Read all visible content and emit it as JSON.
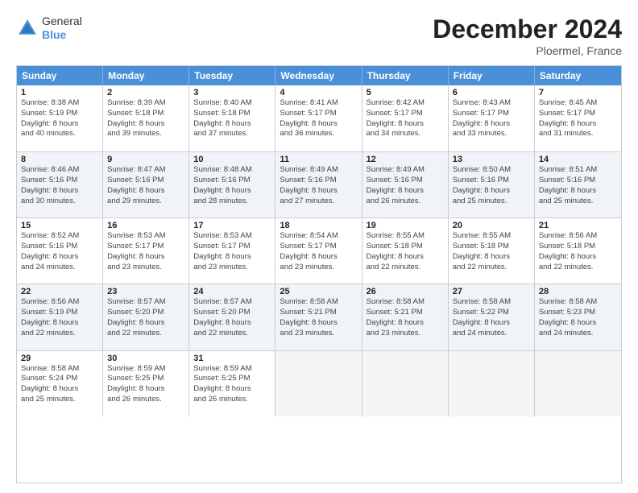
{
  "logo": {
    "general": "General",
    "blue": "Blue"
  },
  "title": "December 2024",
  "location": "Ploermel, France",
  "days": [
    "Sunday",
    "Monday",
    "Tuesday",
    "Wednesday",
    "Thursday",
    "Friday",
    "Saturday"
  ],
  "rows": [
    [
      {
        "day": "1",
        "lines": [
          "Sunrise: 8:38 AM",
          "Sunset: 5:19 PM",
          "Daylight: 8 hours",
          "and 40 minutes."
        ],
        "empty": false,
        "shaded": false
      },
      {
        "day": "2",
        "lines": [
          "Sunrise: 8:39 AM",
          "Sunset: 5:18 PM",
          "Daylight: 8 hours",
          "and 39 minutes."
        ],
        "empty": false,
        "shaded": false
      },
      {
        "day": "3",
        "lines": [
          "Sunrise: 8:40 AM",
          "Sunset: 5:18 PM",
          "Daylight: 8 hours",
          "and 37 minutes."
        ],
        "empty": false,
        "shaded": false
      },
      {
        "day": "4",
        "lines": [
          "Sunrise: 8:41 AM",
          "Sunset: 5:17 PM",
          "Daylight: 8 hours",
          "and 36 minutes."
        ],
        "empty": false,
        "shaded": false
      },
      {
        "day": "5",
        "lines": [
          "Sunrise: 8:42 AM",
          "Sunset: 5:17 PM",
          "Daylight: 8 hours",
          "and 34 minutes."
        ],
        "empty": false,
        "shaded": false
      },
      {
        "day": "6",
        "lines": [
          "Sunrise: 8:43 AM",
          "Sunset: 5:17 PM",
          "Daylight: 8 hours",
          "and 33 minutes."
        ],
        "empty": false,
        "shaded": false
      },
      {
        "day": "7",
        "lines": [
          "Sunrise: 8:45 AM",
          "Sunset: 5:17 PM",
          "Daylight: 8 hours",
          "and 31 minutes."
        ],
        "empty": false,
        "shaded": false
      }
    ],
    [
      {
        "day": "8",
        "lines": [
          "Sunrise: 8:46 AM",
          "Sunset: 5:16 PM",
          "Daylight: 8 hours",
          "and 30 minutes."
        ],
        "empty": false,
        "shaded": true
      },
      {
        "day": "9",
        "lines": [
          "Sunrise: 8:47 AM",
          "Sunset: 5:16 PM",
          "Daylight: 8 hours",
          "and 29 minutes."
        ],
        "empty": false,
        "shaded": true
      },
      {
        "day": "10",
        "lines": [
          "Sunrise: 8:48 AM",
          "Sunset: 5:16 PM",
          "Daylight: 8 hours",
          "and 28 minutes."
        ],
        "empty": false,
        "shaded": true
      },
      {
        "day": "11",
        "lines": [
          "Sunrise: 8:49 AM",
          "Sunset: 5:16 PM",
          "Daylight: 8 hours",
          "and 27 minutes."
        ],
        "empty": false,
        "shaded": true
      },
      {
        "day": "12",
        "lines": [
          "Sunrise: 8:49 AM",
          "Sunset: 5:16 PM",
          "Daylight: 8 hours",
          "and 26 minutes."
        ],
        "empty": false,
        "shaded": true
      },
      {
        "day": "13",
        "lines": [
          "Sunrise: 8:50 AM",
          "Sunset: 5:16 PM",
          "Daylight: 8 hours",
          "and 25 minutes."
        ],
        "empty": false,
        "shaded": true
      },
      {
        "day": "14",
        "lines": [
          "Sunrise: 8:51 AM",
          "Sunset: 5:16 PM",
          "Daylight: 8 hours",
          "and 25 minutes."
        ],
        "empty": false,
        "shaded": true
      }
    ],
    [
      {
        "day": "15",
        "lines": [
          "Sunrise: 8:52 AM",
          "Sunset: 5:16 PM",
          "Daylight: 8 hours",
          "and 24 minutes."
        ],
        "empty": false,
        "shaded": false
      },
      {
        "day": "16",
        "lines": [
          "Sunrise: 8:53 AM",
          "Sunset: 5:17 PM",
          "Daylight: 8 hours",
          "and 23 minutes."
        ],
        "empty": false,
        "shaded": false
      },
      {
        "day": "17",
        "lines": [
          "Sunrise: 8:53 AM",
          "Sunset: 5:17 PM",
          "Daylight: 8 hours",
          "and 23 minutes."
        ],
        "empty": false,
        "shaded": false
      },
      {
        "day": "18",
        "lines": [
          "Sunrise: 8:54 AM",
          "Sunset: 5:17 PM",
          "Daylight: 8 hours",
          "and 23 minutes."
        ],
        "empty": false,
        "shaded": false
      },
      {
        "day": "19",
        "lines": [
          "Sunrise: 8:55 AM",
          "Sunset: 5:18 PM",
          "Daylight: 8 hours",
          "and 22 minutes."
        ],
        "empty": false,
        "shaded": false
      },
      {
        "day": "20",
        "lines": [
          "Sunrise: 8:55 AM",
          "Sunset: 5:18 PM",
          "Daylight: 8 hours",
          "and 22 minutes."
        ],
        "empty": false,
        "shaded": false
      },
      {
        "day": "21",
        "lines": [
          "Sunrise: 8:56 AM",
          "Sunset: 5:18 PM",
          "Daylight: 8 hours",
          "and 22 minutes."
        ],
        "empty": false,
        "shaded": false
      }
    ],
    [
      {
        "day": "22",
        "lines": [
          "Sunrise: 8:56 AM",
          "Sunset: 5:19 PM",
          "Daylight: 8 hours",
          "and 22 minutes."
        ],
        "empty": false,
        "shaded": true
      },
      {
        "day": "23",
        "lines": [
          "Sunrise: 8:57 AM",
          "Sunset: 5:20 PM",
          "Daylight: 8 hours",
          "and 22 minutes."
        ],
        "empty": false,
        "shaded": true
      },
      {
        "day": "24",
        "lines": [
          "Sunrise: 8:57 AM",
          "Sunset: 5:20 PM",
          "Daylight: 8 hours",
          "and 22 minutes."
        ],
        "empty": false,
        "shaded": true
      },
      {
        "day": "25",
        "lines": [
          "Sunrise: 8:58 AM",
          "Sunset: 5:21 PM",
          "Daylight: 8 hours",
          "and 23 minutes."
        ],
        "empty": false,
        "shaded": true
      },
      {
        "day": "26",
        "lines": [
          "Sunrise: 8:58 AM",
          "Sunset: 5:21 PM",
          "Daylight: 8 hours",
          "and 23 minutes."
        ],
        "empty": false,
        "shaded": true
      },
      {
        "day": "27",
        "lines": [
          "Sunrise: 8:58 AM",
          "Sunset: 5:22 PM",
          "Daylight: 8 hours",
          "and 24 minutes."
        ],
        "empty": false,
        "shaded": true
      },
      {
        "day": "28",
        "lines": [
          "Sunrise: 8:58 AM",
          "Sunset: 5:23 PM",
          "Daylight: 8 hours",
          "and 24 minutes."
        ],
        "empty": false,
        "shaded": true
      }
    ],
    [
      {
        "day": "29",
        "lines": [
          "Sunrise: 8:58 AM",
          "Sunset: 5:24 PM",
          "Daylight: 8 hours",
          "and 25 minutes."
        ],
        "empty": false,
        "shaded": false
      },
      {
        "day": "30",
        "lines": [
          "Sunrise: 8:59 AM",
          "Sunset: 5:25 PM",
          "Daylight: 8 hours",
          "and 26 minutes."
        ],
        "empty": false,
        "shaded": false
      },
      {
        "day": "31",
        "lines": [
          "Sunrise: 8:59 AM",
          "Sunset: 5:25 PM",
          "Daylight: 8 hours",
          "and 26 minutes."
        ],
        "empty": false,
        "shaded": false
      },
      {
        "day": "",
        "lines": [],
        "empty": true,
        "shaded": false
      },
      {
        "day": "",
        "lines": [],
        "empty": true,
        "shaded": false
      },
      {
        "day": "",
        "lines": [],
        "empty": true,
        "shaded": false
      },
      {
        "day": "",
        "lines": [],
        "empty": true,
        "shaded": false
      }
    ]
  ]
}
